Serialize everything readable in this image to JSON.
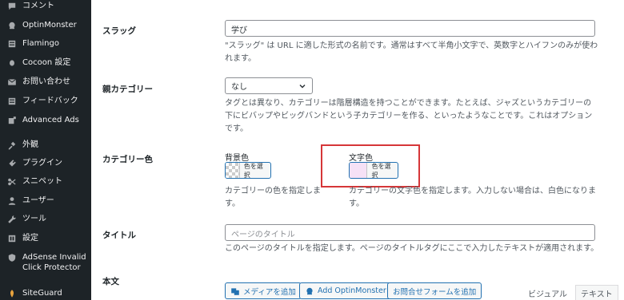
{
  "sidebar": {
    "items": [
      {
        "label": "コメント",
        "icon": "comment-icon"
      },
      {
        "label": "OptinMonster",
        "icon": "optinmonster-icon"
      },
      {
        "label": "Flamingo",
        "icon": "flamingo-icon"
      },
      {
        "label": "Cocoon 設定",
        "icon": "cocoon-icon"
      },
      {
        "label": "お問い合わせ",
        "icon": "mail-icon"
      },
      {
        "label": "フィードバック",
        "icon": "feedback-icon"
      },
      {
        "label": "Advanced Ads",
        "icon": "advanced-ads-icon"
      },
      {
        "label": "外観",
        "icon": "appearance-icon"
      },
      {
        "label": "プラグイン",
        "icon": "plugin-icon"
      },
      {
        "label": "スニペット",
        "icon": "snippet-icon"
      },
      {
        "label": "ユーザー",
        "icon": "user-icon"
      },
      {
        "label": "ツール",
        "icon": "tools-icon"
      },
      {
        "label": "設定",
        "icon": "settings-icon"
      },
      {
        "label": "AdSense Invalid Click Protector",
        "icon": "shield-icon"
      },
      {
        "label": "SiteGuard",
        "icon": "siteguard-icon"
      }
    ]
  },
  "form": {
    "slug": {
      "label": "スラッグ",
      "value": "学び",
      "description": "\"スラッグ\" は URL に適した形式の名前です。通常はすべて半角小文字で、英数字とハイフンのみが使われます。"
    },
    "parent": {
      "label": "親カテゴリー",
      "selected": "なし",
      "description": "タグとは異なり、カテゴリーは階層構造を持つことができます。たとえば、ジャズというカテゴリーの下にビバップやビッグバンドという子カテゴリーを作る、といったようなことです。これはオプションです。"
    },
    "category_color": {
      "label": "カテゴリー色",
      "background": {
        "label": "背景色",
        "button": "色を選択",
        "description": "カテゴリーの色を指定します。"
      },
      "text": {
        "label": "文字色",
        "button": "色を選択",
        "description": "カテゴリーの文字色を指定します。入力しない場合は、白色になります。",
        "swatch_color": "#f6e1f6"
      }
    },
    "title": {
      "label": "タイトル",
      "placeholder": "ページのタイトル",
      "description": "このページのタイトルを指定します。ページのタイトルタグにここで入力したテキストが適用されます。"
    },
    "body": {
      "label": "本文",
      "buttons": [
        "メディアを追加",
        "Add OptinMonster",
        "お問合せフォームを追加"
      ],
      "tabs": [
        "ビジュアル",
        "テキスト"
      ]
    }
  },
  "colors": {
    "highlight": "#d63638",
    "sidebar_bg": "#1d2327",
    "accent": "#2271b1"
  }
}
